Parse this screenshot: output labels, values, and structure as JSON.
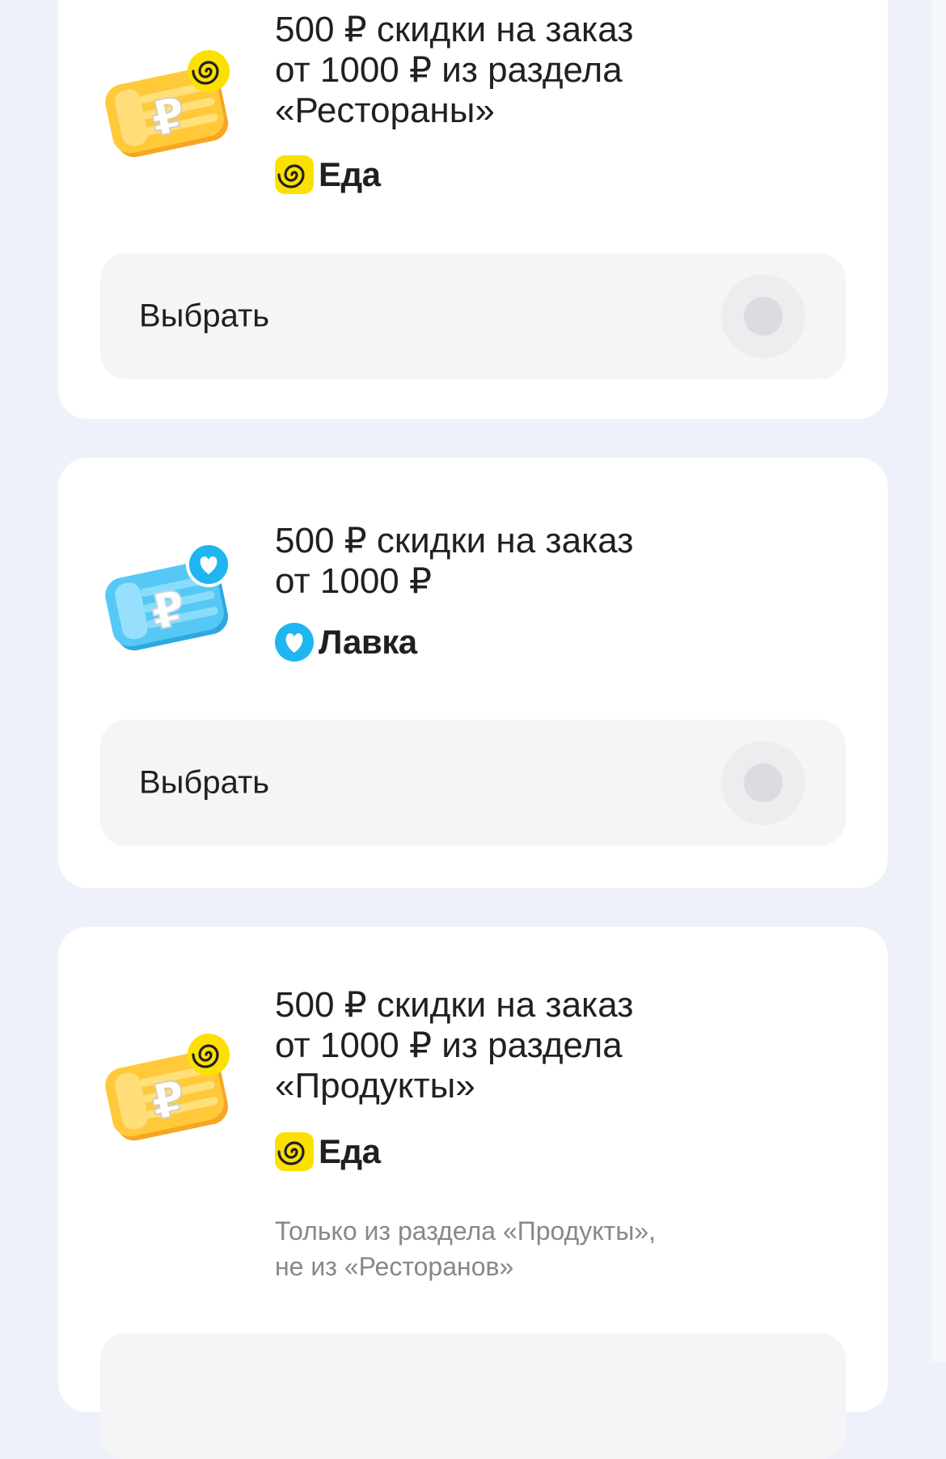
{
  "offers": [
    {
      "title": "500 ₽ скидки на заказ\nот 1000 ₽ из раздела\n«Рестораны»",
      "brand": "Еда",
      "brand_icon": "eda-spiral-icon",
      "ticket_icon": "ruble-ticket-yellow-icon",
      "ticket_color": "#ffc93a",
      "choose_label": "Выбрать",
      "selected": false
    },
    {
      "title": "500 ₽ скидки на заказ\nот 1000 ₽",
      "brand": "Лавка",
      "brand_icon": "lavka-heart-icon",
      "ticket_icon": "ruble-ticket-blue-icon",
      "ticket_color": "#56c8f5",
      "choose_label": "Выбрать",
      "selected": false
    },
    {
      "title": "500 ₽ скидки на заказ\nот 1000 ₽ из раздела\n«Продукты»",
      "brand": "Еда",
      "brand_icon": "eda-spiral-icon",
      "ticket_icon": "ruble-ticket-yellow-icon",
      "ticket_color": "#ffc93a",
      "note": "Только из раздела «Продукты»,\nне из «Ресторанов»"
    }
  ],
  "colors": {
    "background": "#eef1fa",
    "card": "#ffffff",
    "button": "#f5f5f7",
    "eda_yellow": "#fce000",
    "lavka_blue": "#1fb5f0",
    "text": "#21201f",
    "muted_text": "#8a8784"
  }
}
